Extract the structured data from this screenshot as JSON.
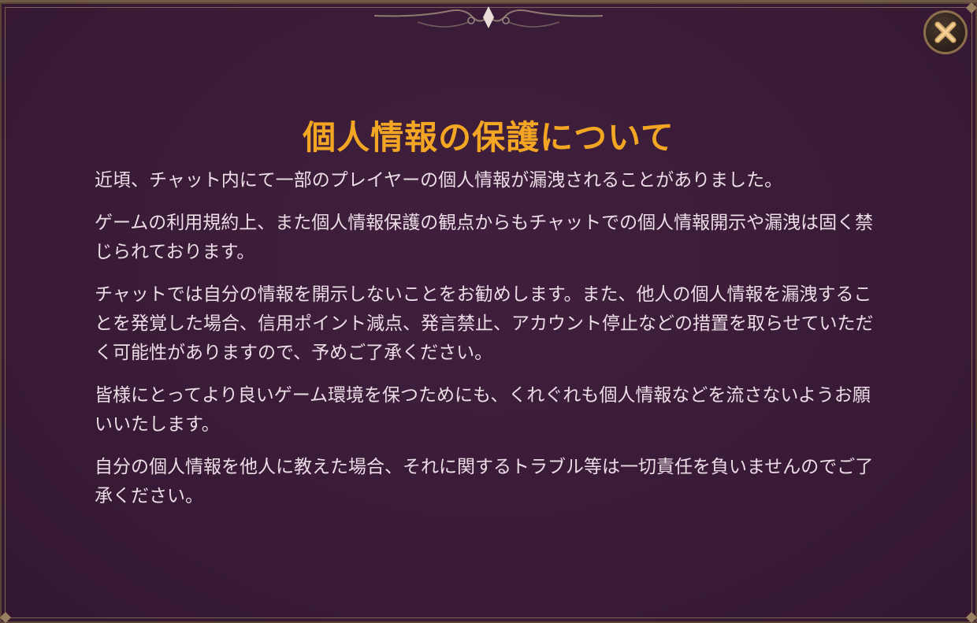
{
  "dialog": {
    "title": "個人情報の保護について",
    "paragraphs": [
      "近頃、チャット内にて一部のプレイヤーの個人情報が漏洩されることがありました。",
      "ゲームの利用規約上、また個人情報保護の観点からもチャットでの個人情報開示や漏洩は固く禁じられております。",
      "チャットでは自分の情報を開示しないことをお勧めします。また、他人の個人情報を漏洩することを発覚した場合、信用ポイント減点、発言禁止、アカウント停止などの措置を取らせていただく可能性がありますので、予めご了承ください。",
      "皆様にとってより良いゲーム環境を保つためにも、くれぐれも個人情報などを流さないようお願いいたします。",
      "自分の個人情報を他人に教えた場合、それに関するトラブル等は一切責任を負いませんのでご了承ください。"
    ],
    "close_icon": "close-x-icon"
  },
  "colors": {
    "background": "#3a1b37",
    "title": "#f2a623",
    "text": "#ecdde6",
    "border": "#7b6350"
  }
}
